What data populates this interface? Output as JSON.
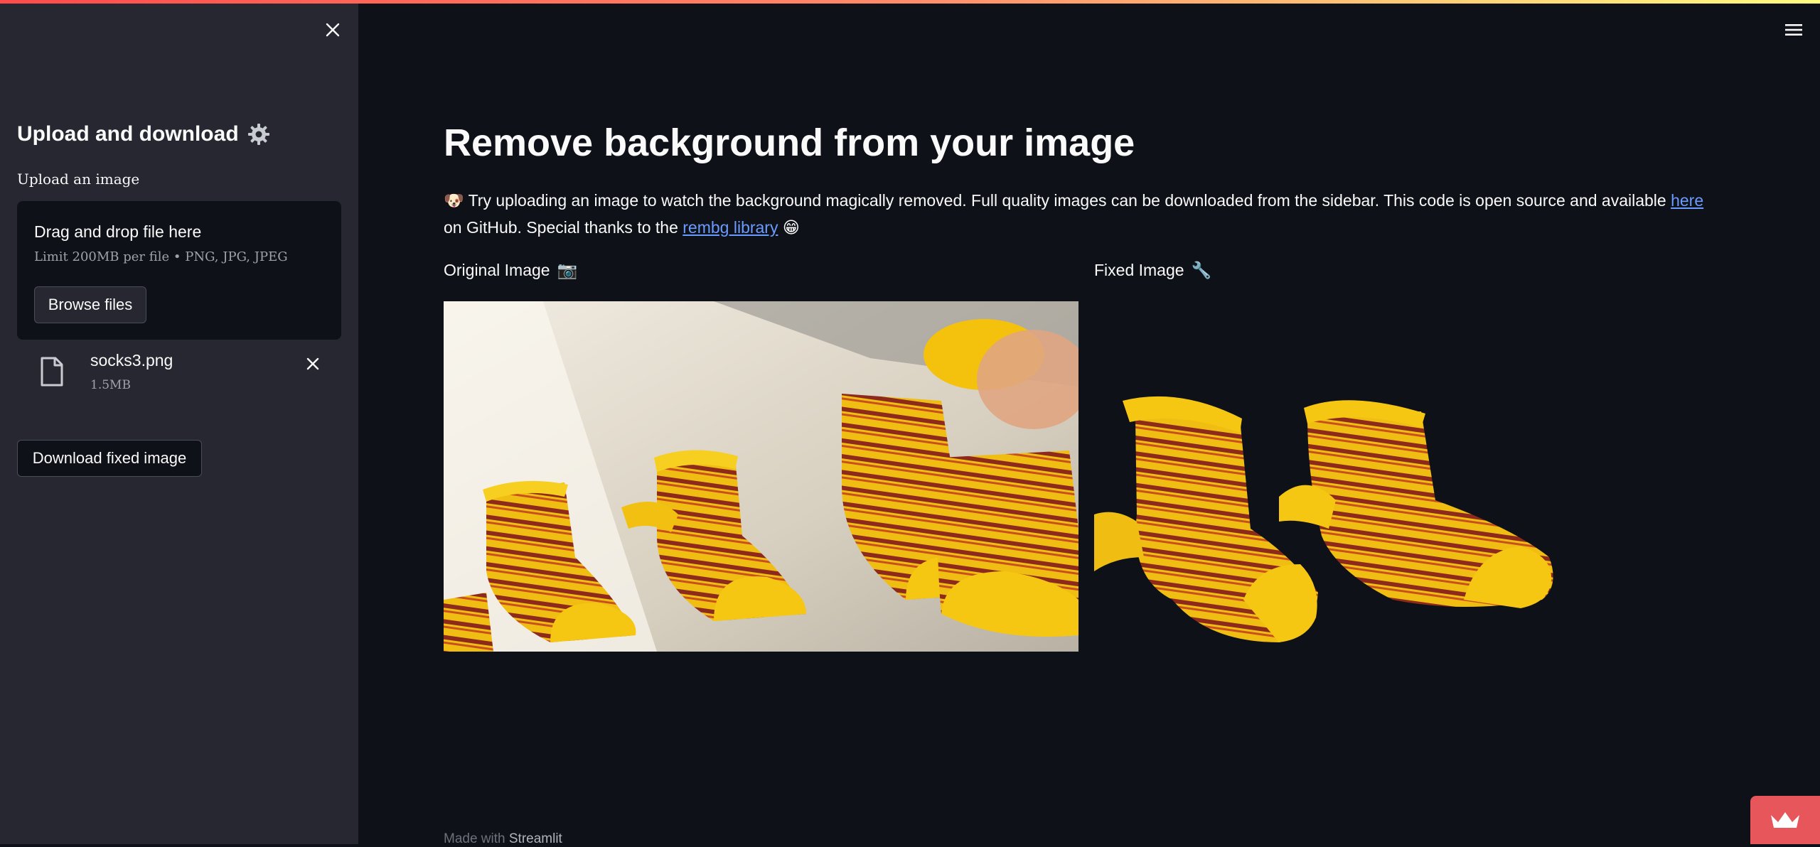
{
  "sidebar": {
    "title": "Upload and download",
    "upload_label": "Upload an image",
    "dropzone": {
      "title": "Drag and drop file here",
      "limit": "Limit 200MB per file • PNG, JPG, JPEG",
      "browse_label": "Browse files"
    },
    "file": {
      "name": "socks3.png",
      "size": "1.5MB"
    },
    "download_label": "Download fixed image"
  },
  "main": {
    "title": "Remove background from your image",
    "intro": {
      "emoji": "🐶",
      "text1": " Try uploading an image to watch the background magically removed. Full quality images can be downloaded from the sidebar. This code is open source and available ",
      "link1": "here",
      "text2": " on GitHub. Special thanks to the ",
      "link2": "rembg library",
      "text3": " 😁"
    },
    "original_label": "Original Image",
    "original_emoji": "📷",
    "fixed_label": "Fixed Image",
    "fixed_emoji": "🔧"
  },
  "footer": {
    "prefix": "Made with ",
    "brand": "Streamlit"
  },
  "colors": {
    "background": "#0e1117",
    "sidebar": "#262730",
    "link": "#6b9bff",
    "badge": "#e6565b",
    "sock_yellow": "#f2c200",
    "sock_stripe": "#8b2a1c"
  },
  "icons": {
    "close": "close-icon",
    "gear": "gear-icon",
    "file": "file-icon",
    "remove": "close-icon",
    "menu": "hamburger-menu-icon",
    "crown": "crown-icon"
  }
}
